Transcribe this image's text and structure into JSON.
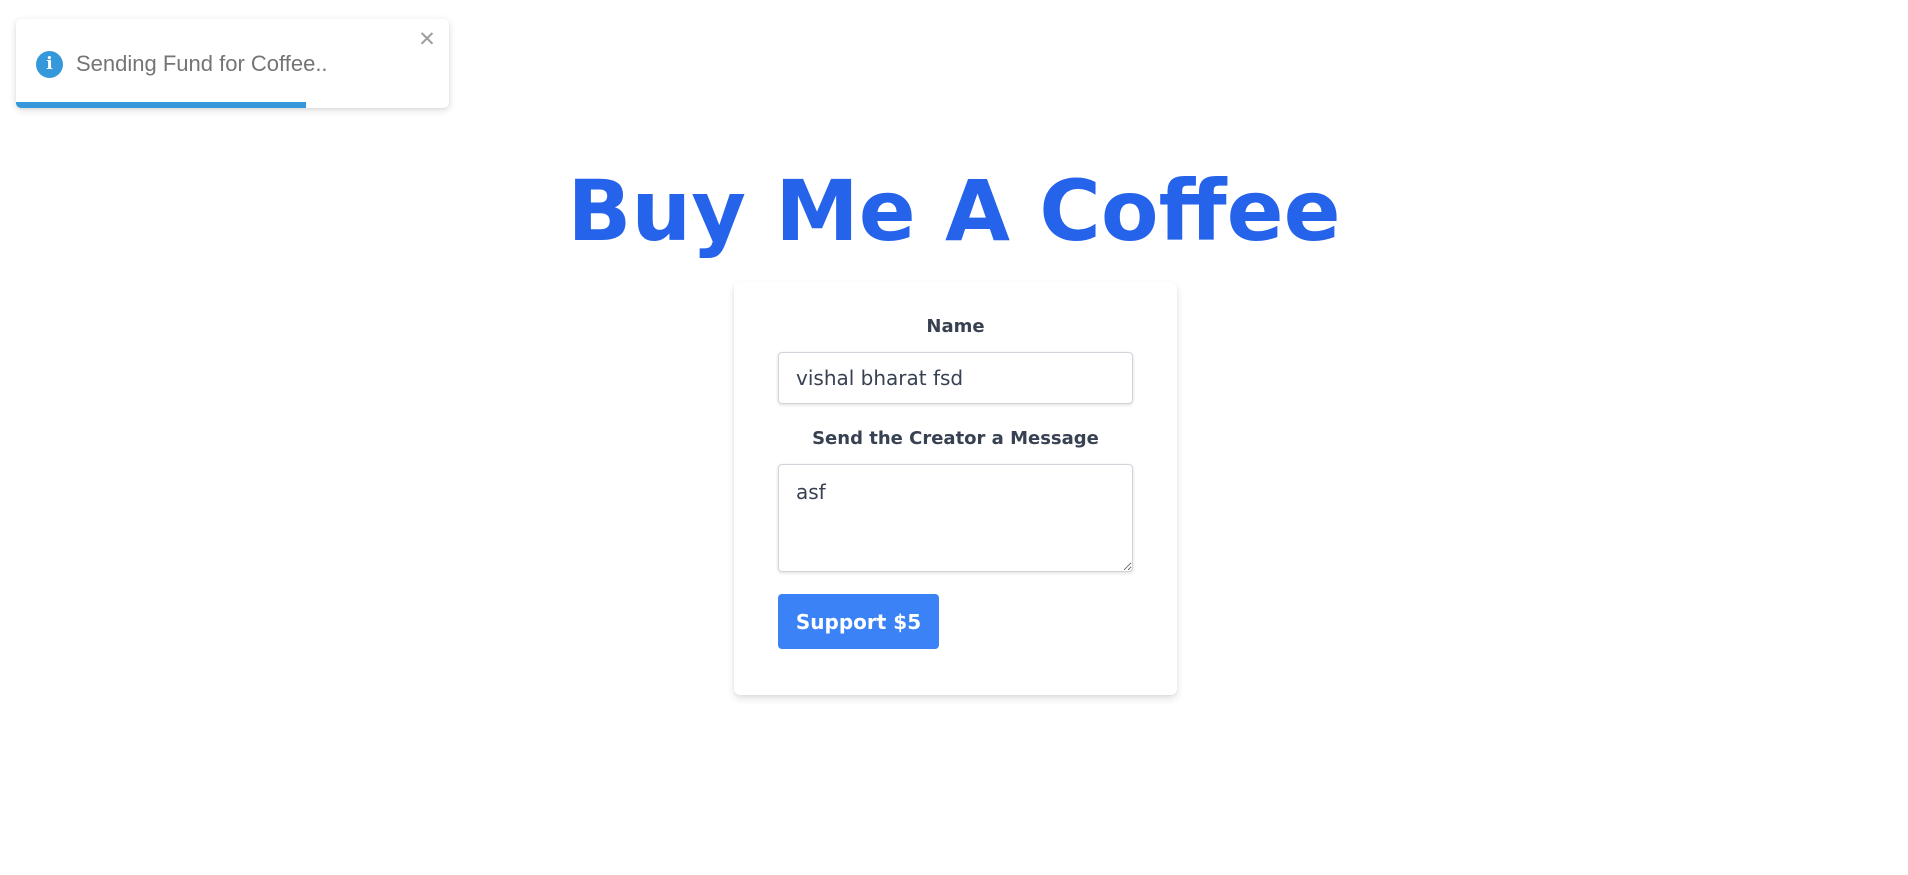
{
  "toast": {
    "icon": "info-icon",
    "message": "Sending Fund for Coffee..",
    "close_glyph": "✕",
    "progress_fraction": 0.67,
    "accent_color": "#3498db"
  },
  "page": {
    "title": "Buy Me A Coffee",
    "title_color": "#2563eb"
  },
  "form": {
    "name_label": "Name",
    "name_value": "vishal bharat fsd",
    "message_label": "Send the Creator a Message",
    "message_value": "asf",
    "submit_label": "Support $5",
    "button_color": "#3b82f6"
  }
}
